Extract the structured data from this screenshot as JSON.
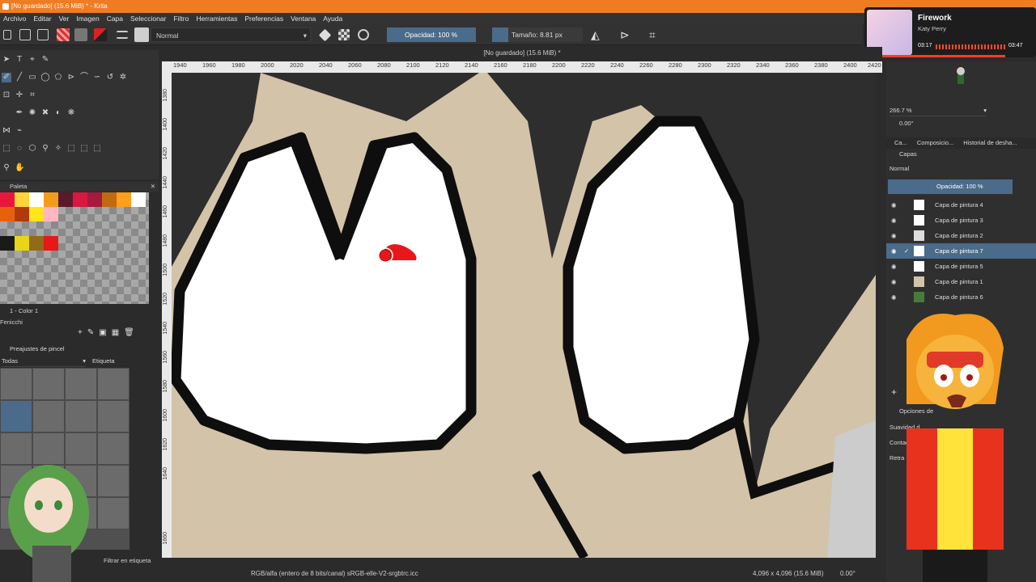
{
  "window": {
    "title": "[No guardado]  (15.6 MiB) * - Krita"
  },
  "menu": [
    "Archivo",
    "Editar",
    "Ver",
    "Imagen",
    "Capa",
    "Seleccionar",
    "Filtro",
    "Herramientas",
    "Preferencias",
    "Ventana",
    "Ayuda"
  ],
  "toolbar": {
    "blend_mode": "Normal",
    "opacity_label": "Opacidad: 100 %",
    "size_label": "Tamaño: 8.81 px"
  },
  "canvas_tab": {
    "title": "[No guardado]  (15.6 MiB) *"
  },
  "ruler": {
    "h_ticks": [
      "1940",
      "1960",
      "1980",
      "2000",
      "2020",
      "2040",
      "2060",
      "2080",
      "2100",
      "2120",
      "2140",
      "2160",
      "2180",
      "2200",
      "2220",
      "2240",
      "2260",
      "2280",
      "2300",
      "2320",
      "2340",
      "2360",
      "2380",
      "2400",
      "2420"
    ],
    "v_ticks": [
      "1380",
      "1400",
      "1420",
      "1440",
      "1460",
      "1480",
      "1500",
      "1520",
      "1540",
      "1560",
      "1580",
      "1600",
      "1620",
      "1640",
      "1660"
    ]
  },
  "palette": {
    "title": "Paleta",
    "colors": [
      "#e8183c",
      "#ffd33a",
      "#ffffff",
      "#f39c1b",
      "#5a1a2b",
      "#d8183e",
      "#a61a3e",
      "#c06a12",
      "#ff9f1a",
      "#ffffff",
      "#e8600c",
      "#b03a0c",
      "#ffe51a",
      "#1a1a1a",
      "#e8d51a",
      "#8f6b1a",
      "#e81818",
      "#ffb6c1"
    ],
    "footer_label": "1 - Color 1",
    "set_name": "Fenicchi"
  },
  "presets": {
    "title": "Preajustes de pincel",
    "filter_all": "Todas",
    "tag_label": "Etiqueta",
    "filter_tag": "Filtrar en etiqueta"
  },
  "status": {
    "color_space": "RGB/alfa (entero de 8 bits/canal)  sRGB-elle-V2-srgbtrc.icc",
    "doc_size": "4,096 x 4,096 (15.6 MiB)",
    "rotation": "0.00°"
  },
  "view": {
    "zoom": "266.7 %",
    "rotation": "0.00°"
  },
  "layers_panel": {
    "tabs": [
      "Ca...",
      "Composicio...",
      "Historial de desha..."
    ],
    "title": "Capas",
    "blend": "Normal",
    "opacity_label": "Opacidad:  100 %",
    "layers": [
      "Capa de pintura 4",
      "Capa de pintura 3",
      "Capa de pintura 2",
      "Capa de pintura 7",
      "Capa de pintura 5",
      "Capa de pintura 1",
      "Capa de pintura 6"
    ],
    "selected_index": 3
  },
  "tool_options": {
    "title": "Opciones de",
    "rows": [
      "Suavidad d",
      "Contad",
      "Retra"
    ]
  },
  "media": {
    "song": "Firework",
    "artist": "Katy Perry",
    "elapsed": "03:17",
    "total": "03:47"
  },
  "colors": {
    "accent": "#f07c22",
    "selection": "#4a6b8a",
    "skin": "#d3c3a9"
  }
}
